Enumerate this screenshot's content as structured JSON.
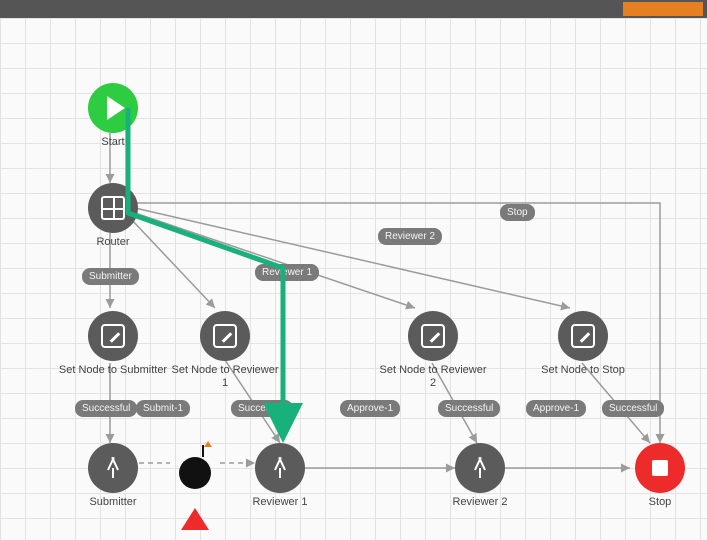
{
  "toolbar": {
    "action": ""
  },
  "nodes": {
    "start": {
      "label": "Start"
    },
    "router": {
      "label": "Router"
    },
    "set_sub": {
      "label": "Set Node to Submitter"
    },
    "set_r1": {
      "label": "Set Node to Reviewer 1"
    },
    "set_r2": {
      "label": "Set Node to Reviewer 2"
    },
    "set_stop": {
      "label": "Set Node to Stop"
    },
    "submitter": {
      "label": "Submitter"
    },
    "reviewer1": {
      "label": "Reviewer 1"
    },
    "reviewer2": {
      "label": "Reviewer 2"
    },
    "stop": {
      "label": "Stop"
    }
  },
  "edges": {
    "submitter": "Submitter",
    "reviewer1": "Reviewer 1",
    "reviewer2": "Reviewer 2",
    "stop": "Stop",
    "successful": "Successful",
    "submit1": "Submit-1",
    "approve1": "Approve-1"
  },
  "highlight_path": "Start → Router → Reviewer 1"
}
